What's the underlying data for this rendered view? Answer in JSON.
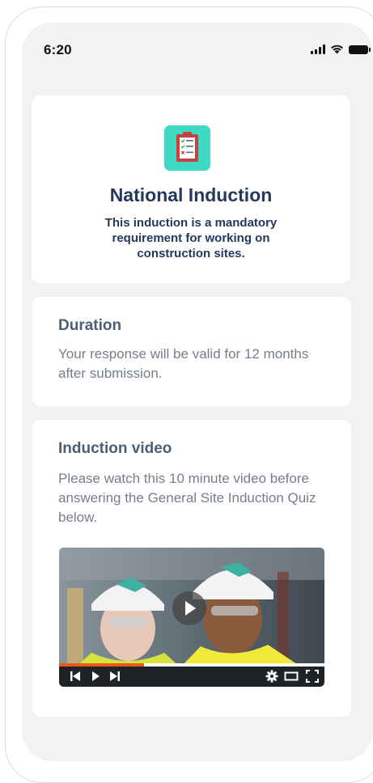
{
  "status_bar": {
    "time": "6:20"
  },
  "hero": {
    "icon": "clipboard-checklist-icon",
    "title": "National Induction",
    "description": "This induction is a mandatory requirement for working on construction sites."
  },
  "duration": {
    "heading": "Duration",
    "text": "Your response will be valid for 12 months after submission."
  },
  "video": {
    "heading": "Induction video",
    "text": "Please watch this 10 minute video before answering the General Site Induction Quiz below.",
    "progress": 0.32,
    "accent_color": "#e65a1e"
  },
  "colors": {
    "heading": "#24395c",
    "icon_bg": "#3fd9c4",
    "screen_bg": "#f1f2f4"
  }
}
